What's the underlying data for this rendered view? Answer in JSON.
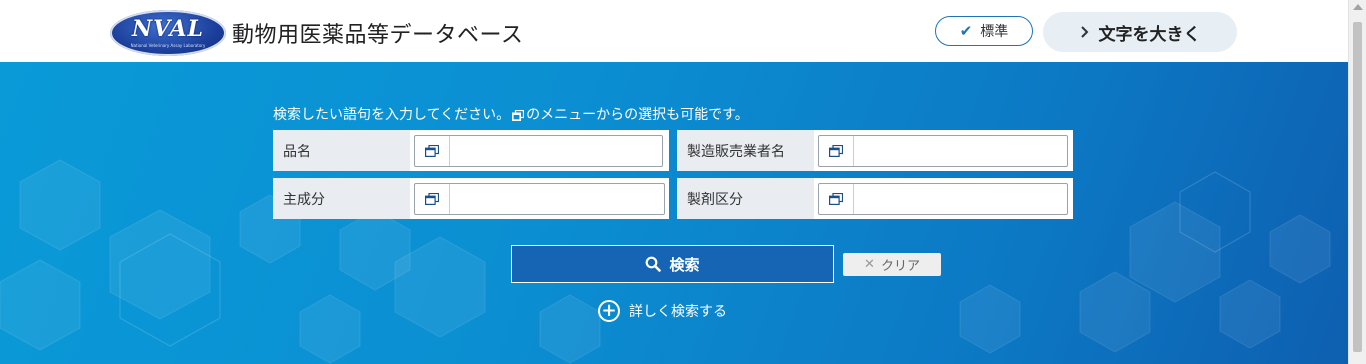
{
  "header": {
    "logo_text": "NVAL",
    "logo_sub": "National Veterinary Assay Laboratory",
    "title": "動物用医薬品等データベース",
    "standard_label": "標準",
    "large_label": "文字を大きく"
  },
  "search": {
    "instruction_before": "検索したい語句を入力してください。",
    "instruction_after": "のメニューからの選択も可能です。",
    "fields": [
      {
        "label": "品名",
        "value": ""
      },
      {
        "label": "製造販売業者名",
        "value": ""
      },
      {
        "label": "主成分",
        "value": ""
      },
      {
        "label": "製剤区分",
        "value": ""
      }
    ],
    "search_label": "検索",
    "clear_label": "クリア",
    "advanced_label": "詳しく検索する"
  },
  "icons": {
    "check": "check-icon",
    "chevron": "chevron-right-icon",
    "menu": "window-menu-icon",
    "search": "search-icon",
    "clear": "close-icon",
    "plus": "plus-circle-icon"
  },
  "colors": {
    "accent": "#1f74b8",
    "hero_start": "#0a9ad8",
    "hero_end": "#0e5fb0",
    "search_button": "#1565b4"
  }
}
